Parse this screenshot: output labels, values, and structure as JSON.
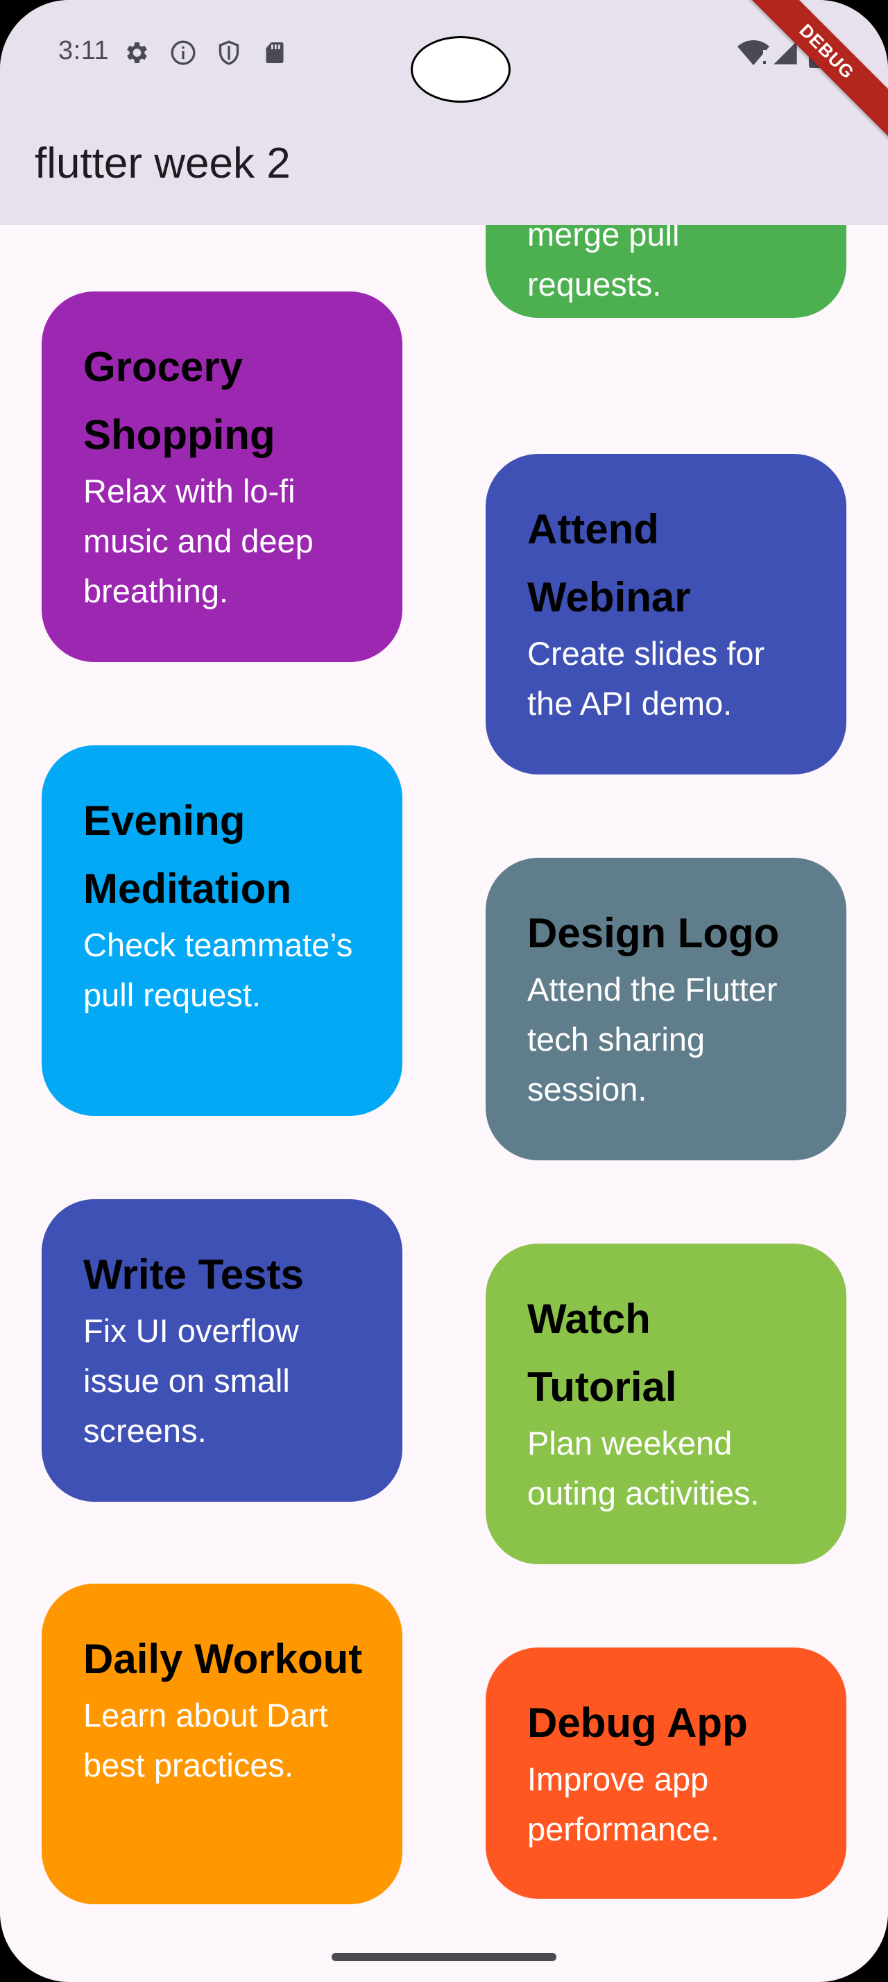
{
  "status_bar": {
    "time": "3:11",
    "icons": [
      "gear-icon",
      "info-icon",
      "shield-icon",
      "sd-card-icon",
      "wifi-icon",
      "signal-icon",
      "battery-icon"
    ]
  },
  "debug_banner": "DEBUG",
  "app_bar": {
    "title": "flutter week 2"
  },
  "colors": {
    "purple": "#9c27b0",
    "light_blue": "#03a9f4",
    "indigo": "#3f51b5",
    "orange": "#ff9800",
    "green": "#4caf50",
    "blue_grey": "#607d8b",
    "light_green": "#8bc34a",
    "deep_orange": "#ff5722",
    "app_bar_bg": "#e6e1ec",
    "page_bg": "#fdf6fb"
  },
  "cards": [
    {
      "title": "",
      "desc": "merge pull requests.",
      "color": "#4caf50"
    },
    {
      "title": "Grocery Shopping",
      "desc": "Relax with lo-fi music and deep breathing.",
      "color": "#9c27b0"
    },
    {
      "title": "Attend Webinar",
      "desc": "Create slides for the API demo.",
      "color": "#3f51b5"
    },
    {
      "title": "Evening Meditation",
      "desc": "Check teammate’s pull request.",
      "color": "#03a9f4"
    },
    {
      "title": "Design Logo",
      "desc": "Attend the Flutter tech sharing session.",
      "color": "#607d8b"
    },
    {
      "title": "Write Tests",
      "desc": "Fix UI overflow issue on small screens.",
      "color": "#3f51b5"
    },
    {
      "title": "Watch Tutorial",
      "desc": "Plan weekend outing activities.",
      "color": "#8bc34a"
    },
    {
      "title": "Daily Workout",
      "desc": "Learn about Dart best practices.",
      "color": "#ff9800"
    },
    {
      "title": "Debug App",
      "desc": "Improve app performance.",
      "color": "#ff5722"
    }
  ]
}
